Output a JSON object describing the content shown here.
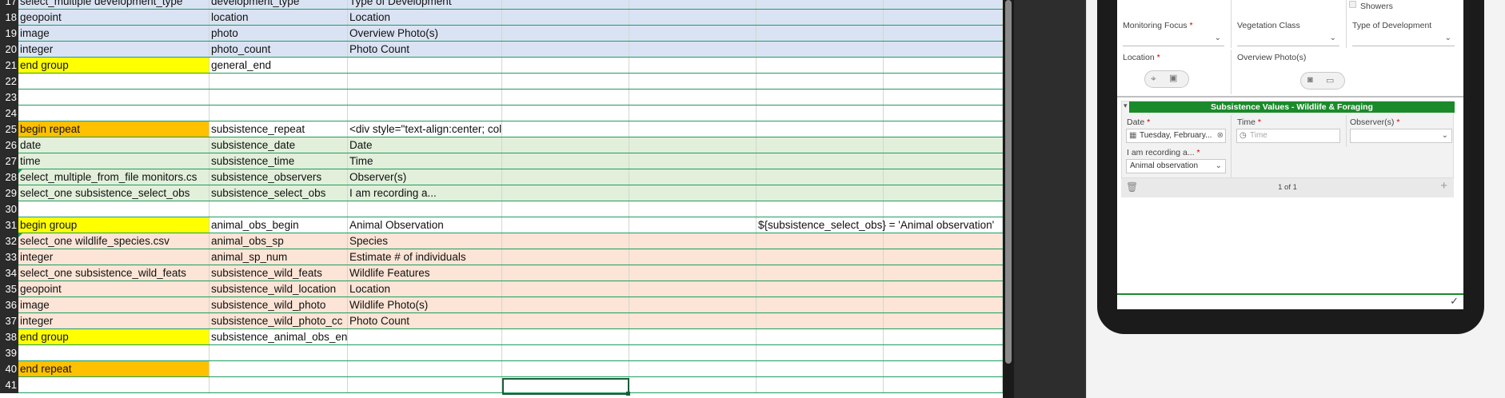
{
  "sheet": {
    "rows": [
      {
        "num": "17",
        "cells": [
          "select_multiple development_type",
          "development_type",
          "Type of Development"
        ],
        "color": "blue"
      },
      {
        "num": "18",
        "cells": [
          "geopoint",
          "location",
          "Location"
        ],
        "color": "blue"
      },
      {
        "num": "19",
        "cells": [
          "image",
          "photo",
          "Overview Photo(s)"
        ],
        "color": "blue"
      },
      {
        "num": "20",
        "cells": [
          "integer",
          "photo_count",
          "Photo Count"
        ],
        "color": "blue"
      },
      {
        "num": "21",
        "cells": [
          "end group",
          "general_end",
          ""
        ],
        "color": "none",
        "hl": "yellow"
      },
      {
        "num": "22",
        "cells": [
          "",
          "",
          ""
        ],
        "color": "none"
      },
      {
        "num": "23",
        "cells": [
          "",
          "",
          ""
        ],
        "color": "none"
      },
      {
        "num": "24",
        "cells": [
          "",
          "",
          ""
        ],
        "color": "none"
      },
      {
        "num": "25",
        "cells": [
          "begin repeat",
          "subsistence_repeat",
          "<div style=\"text-align:center; color:white; font-weight:bo"
        ],
        "color": "none",
        "hl": "orange"
      },
      {
        "num": "26",
        "cells": [
          "date",
          "subsistence_date",
          "Date"
        ],
        "color": "green"
      },
      {
        "num": "27",
        "cells": [
          "time",
          "subsistence_time",
          "Time"
        ],
        "color": "green"
      },
      {
        "num": "28",
        "cells": [
          "select_multiple_from_file monitors.cs",
          "subsistence_observers",
          "Observer(s)"
        ],
        "color": "green",
        "tri": true
      },
      {
        "num": "29",
        "cells": [
          "select_one subsistence_select_obs",
          "subsistence_select_obs",
          "I am recording a..."
        ],
        "color": "green"
      },
      {
        "num": "30",
        "cells": [
          "",
          "",
          ""
        ],
        "color": "none"
      },
      {
        "num": "31",
        "cells": [
          "begin group",
          "animal_obs_begin",
          "Animal Observation"
        ],
        "color": "none",
        "hl": "yellow",
        "relevant": "${subsistence_select_obs} = 'Animal observation'"
      },
      {
        "num": "32",
        "cells": [
          "select_one  wildlife_species.csv",
          "animal_obs_sp",
          "Species"
        ],
        "color": "peach",
        "tri": true
      },
      {
        "num": "33",
        "cells": [
          "integer",
          "animal_sp_num",
          "Estimate # of individuals"
        ],
        "color": "peach"
      },
      {
        "num": "34",
        "cells": [
          "select_one subsistence_wild_feats",
          "subsistence_wild_feats",
          "Wildlife Features"
        ],
        "color": "peach"
      },
      {
        "num": "35",
        "cells": [
          "geopoint",
          "subsistence_wild_location",
          "Location"
        ],
        "color": "peach"
      },
      {
        "num": "36",
        "cells": [
          "image",
          "subsistence_wild_photo",
          "Wildlife Photo(s)"
        ],
        "color": "peach"
      },
      {
        "num": "37",
        "cells": [
          "integer",
          "subsistence_wild_photo_cc",
          "Photo Count"
        ],
        "color": "peach"
      },
      {
        "num": "38",
        "cells": [
          "end group",
          "subsistence_animal_obs_end",
          ""
        ],
        "color": "none",
        "hl": "yellow"
      },
      {
        "num": "39",
        "cells": [
          "",
          "",
          ""
        ],
        "color": "none"
      },
      {
        "num": "40",
        "cells": [
          "end repeat",
          "",
          ""
        ],
        "color": "none",
        "hl": "orange"
      },
      {
        "num": "41",
        "cells": [
          "",
          "",
          ""
        ],
        "color": "none"
      }
    ]
  },
  "preview": {
    "showers": "Showers",
    "monitoring_focus": "Monitoring Focus",
    "vegetation_class": "Vegetation Class",
    "type_of_development": "Type of Development",
    "location": "Location",
    "overview_photos": "Overview Photo(s)",
    "required_mark": "*",
    "group_title": "Subsistence Values - Wildlife & Foraging",
    "date_label": "Date",
    "date_value": "Tuesday, February...",
    "time_label": "Time",
    "time_placeholder": "Time",
    "observers_label": "Observer(s)",
    "recording_label": "I am recording a...",
    "recording_value": "Animal observation",
    "pager": "1 of 1",
    "add": "+",
    "check": "✓"
  },
  "colors": {
    "blue_band": "#dae3f3",
    "green_band": "#e2efda",
    "peach_band": "#fce4d6",
    "yellow": "#ffff00",
    "orange": "#ffc000",
    "grid_line": "#1f9e5f",
    "group_header": "#1a8a2a"
  }
}
